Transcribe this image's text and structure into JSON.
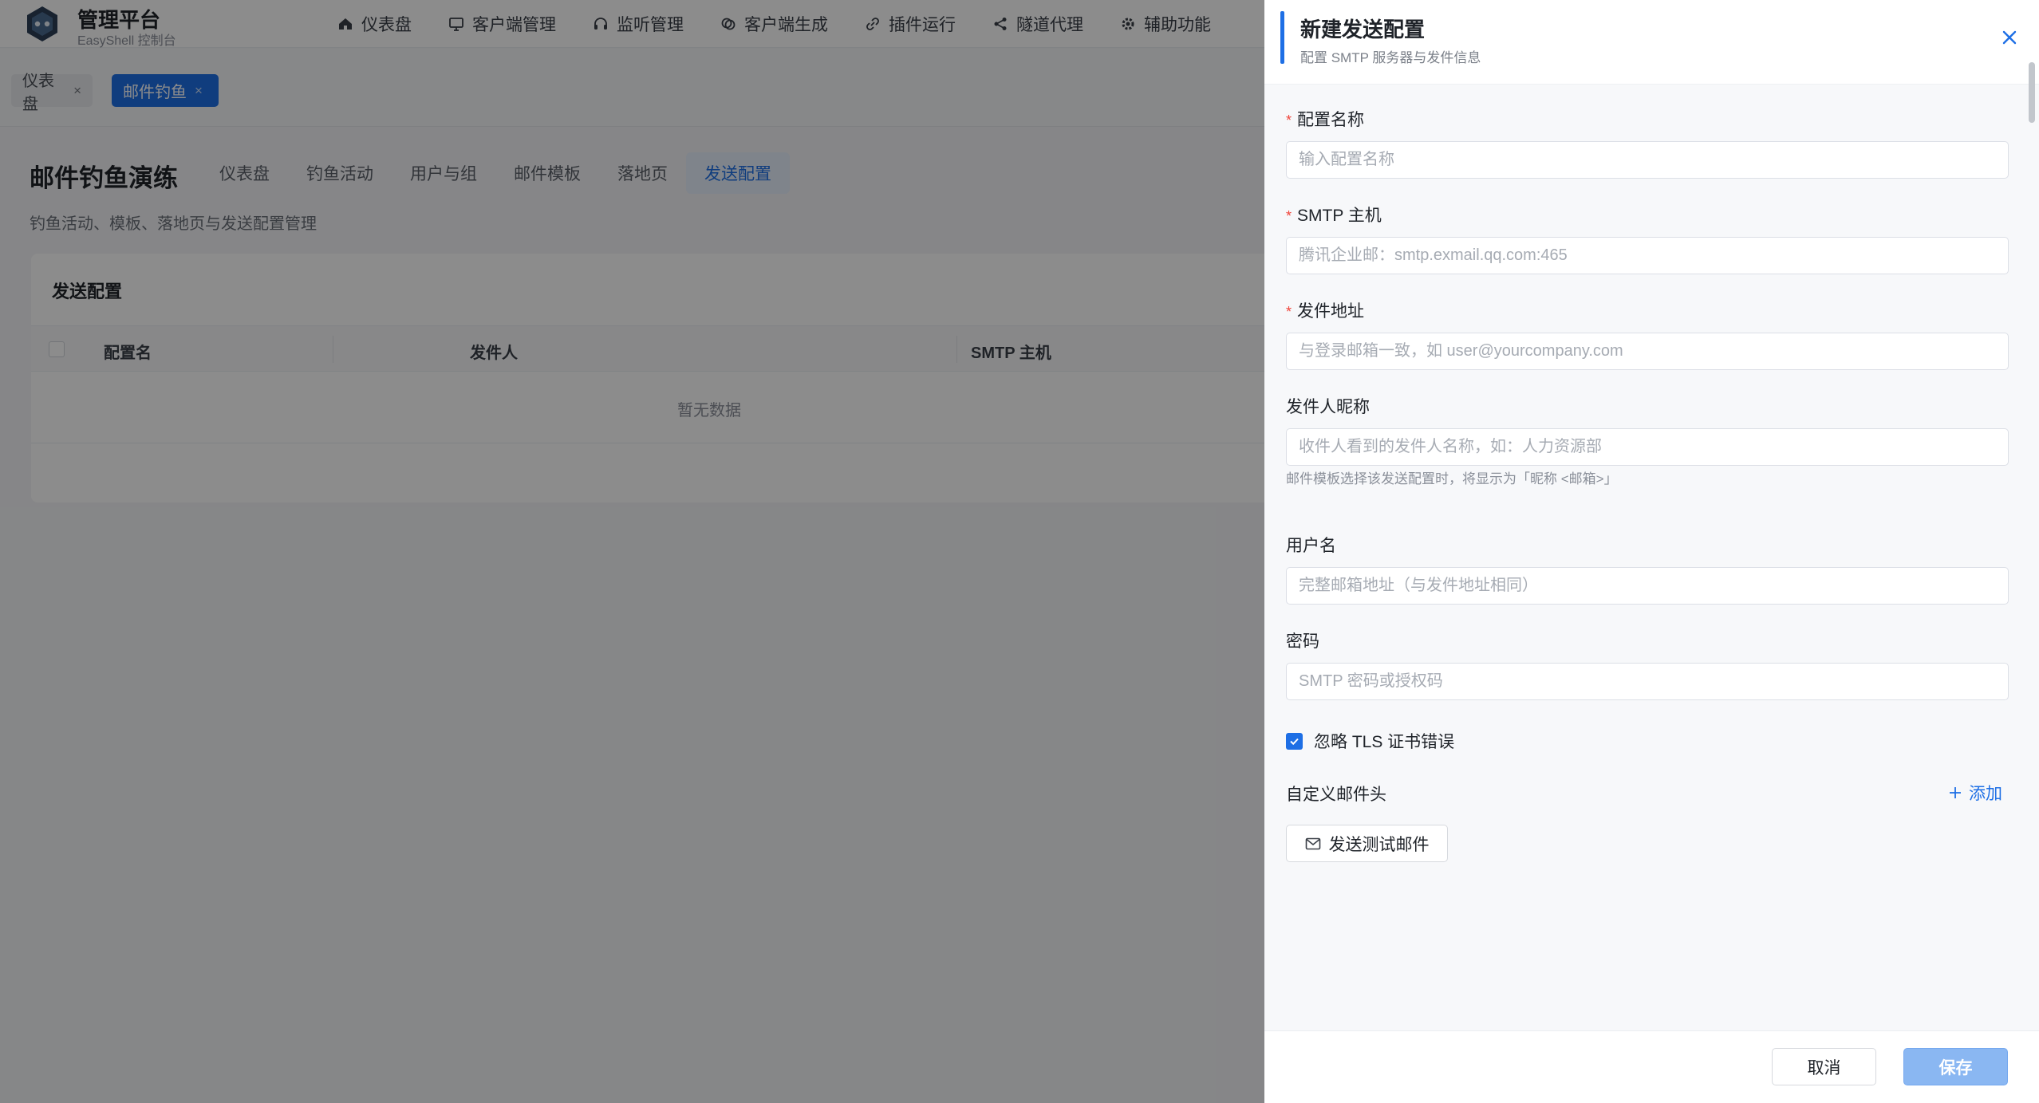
{
  "brand": {
    "title": "管理平台",
    "subtitle": "EasyShell 控制台"
  },
  "nav": [
    {
      "label": "仪表盘",
      "icon": "home-icon"
    },
    {
      "label": "客户端管理",
      "icon": "monitor-icon"
    },
    {
      "label": "监听管理",
      "icon": "headset-icon"
    },
    {
      "label": "客户端生成",
      "icon": "layers-icon"
    },
    {
      "label": "插件运行",
      "icon": "link-icon"
    },
    {
      "label": "隧道代理",
      "icon": "share-icon"
    },
    {
      "label": "辅助功能",
      "icon": "gear-icon"
    }
  ],
  "tags": [
    {
      "label": "仪表盘",
      "close": "×"
    },
    {
      "label": "邮件钓鱼",
      "close": "×"
    }
  ],
  "page": {
    "title": "邮件钓鱼演练",
    "description": "钓鱼活动、模板、落地页与发送配置管理",
    "tabs": [
      "仪表盘",
      "钓鱼活动",
      "用户与组",
      "邮件模板",
      "落地页",
      "发送配置"
    ],
    "active_tab": "发送配置"
  },
  "card": {
    "title": "发送配置",
    "columns": [
      "配置名",
      "发件人",
      "SMTP 主机"
    ],
    "empty_text": "暂无数据"
  },
  "drawer": {
    "title": "新建发送配置",
    "subtitle": "配置 SMTP 服务器与发件信息",
    "fields": {
      "name": {
        "label": "配置名称",
        "required": "*",
        "placeholder": "输入配置名称"
      },
      "host": {
        "label": "SMTP 主机",
        "required": "*",
        "placeholder": "腾讯企业邮：smtp.exmail.qq.com:465"
      },
      "from": {
        "label": "发件地址",
        "required": "*",
        "placeholder": "与登录邮箱一致，如 user@yourcompany.com"
      },
      "nickname": {
        "label": "发件人昵称",
        "placeholder": "收件人看到的发件人名称，如：人力资源部",
        "hint": "邮件模板选择该发送配置时，将显示为「昵称 <邮箱>」"
      },
      "username": {
        "label": "用户名",
        "placeholder": "完整邮箱地址（与发件地址相同）"
      },
      "password": {
        "label": "密码",
        "placeholder": "SMTP 密码或授权码"
      }
    },
    "tls": {
      "label": "忽略 TLS 证书错误",
      "checked": true
    },
    "headers": {
      "label": "自定义邮件头",
      "add_label": "添加"
    },
    "test_button": "发送测试邮件",
    "cancel_button": "取消",
    "save_button": "保存"
  },
  "colors": {
    "accent": "#1e6fe5",
    "required": "#f0443a"
  }
}
